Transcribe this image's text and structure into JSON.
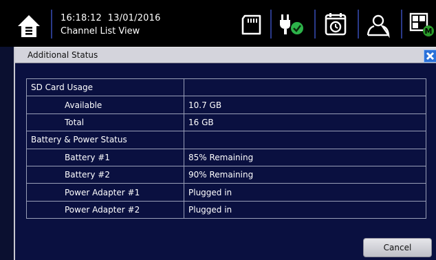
{
  "header": {
    "time": "16:18:12",
    "date": "13/01/2016",
    "view_name": "Channel List View",
    "icons": [
      "home-icon",
      "sd-card-icon",
      "power-plug-check-icon",
      "alarm-clock-icon",
      "user-icon",
      "layout-grid-icon"
    ]
  },
  "dialog": {
    "title": "Additional Status",
    "close_icon": "close-icon",
    "cancel_label": "Cancel",
    "rows": [
      {
        "label": "SD Card Usage",
        "value": ""
      },
      {
        "label": "Available",
        "value": "10.7 GB"
      },
      {
        "label": "Total",
        "value": "16 GB"
      },
      {
        "label": "Battery & Power Status",
        "value": ""
      },
      {
        "label": "Battery #1",
        "value": "85% Remaining"
      },
      {
        "label": "Battery #2",
        "value": "90% Remaining"
      },
      {
        "label": "Power Adapter #1",
        "value": "Plugged in"
      },
      {
        "label": "Power Adapter #2",
        "value": "Plugged in"
      }
    ]
  },
  "colors": {
    "background": "#0b1030",
    "topbar": "#000000",
    "title_bar": "#d4d4dc",
    "close_button": "#2a70d8",
    "status_ok_green": "#2db34a",
    "badge_green": "#2a9a2a"
  }
}
